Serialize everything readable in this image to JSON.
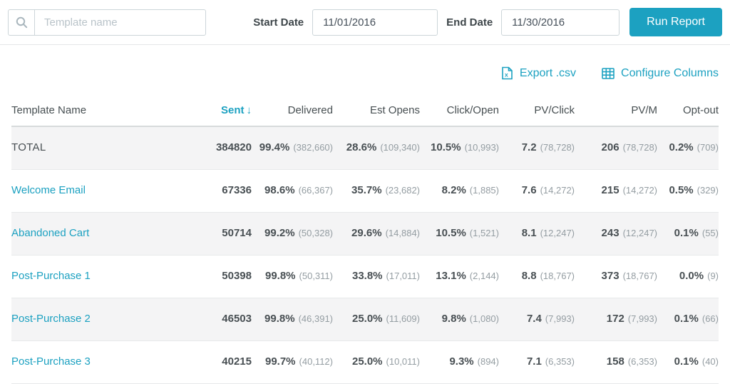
{
  "colors": {
    "accent": "#1ca1c1",
    "text_dark": "#474e52",
    "text_sub": "#949da2",
    "stripe": "#f4f4f5"
  },
  "toolbar": {
    "search_placeholder": "Template name",
    "start_date_label": "Start Date",
    "start_date_value": "11/01/2016",
    "end_date_label": "End Date",
    "end_date_value": "11/30/2016",
    "run_report_label": "Run Report"
  },
  "actions": {
    "export_csv_label": "Export .csv",
    "configure_columns_label": "Configure Columns"
  },
  "table": {
    "sort_arrow": "↓",
    "columns": [
      {
        "key": "name",
        "label": "Template Name",
        "align": "left"
      },
      {
        "key": "sent",
        "label": "Sent",
        "sorted": "desc"
      },
      {
        "key": "delivered",
        "label": "Delivered"
      },
      {
        "key": "est_opens",
        "label": "Est Opens"
      },
      {
        "key": "click_open",
        "label": "Click/Open"
      },
      {
        "key": "pv_click",
        "label": "PV/Click"
      },
      {
        "key": "pv_m",
        "label": "PV/M"
      },
      {
        "key": "opt_out",
        "label": "Opt-out"
      }
    ],
    "rows": [
      {
        "name": "TOTAL",
        "is_total": true,
        "sent": "384820",
        "delivered": {
          "main": "99.4%",
          "sub": "(382,660)"
        },
        "est_opens": {
          "main": "28.6%",
          "sub": "(109,340)"
        },
        "click_open": {
          "main": "10.5%",
          "sub": "(10,993)"
        },
        "pv_click": {
          "main": "7.2",
          "sub": "(78,728)"
        },
        "pv_m": {
          "main": "206",
          "sub": "(78,728)"
        },
        "opt_out": {
          "main": "0.2%",
          "sub": "(709)"
        }
      },
      {
        "name": "Welcome Email",
        "is_total": false,
        "sent": "67336",
        "delivered": {
          "main": "98.6%",
          "sub": "(66,367)"
        },
        "est_opens": {
          "main": "35.7%",
          "sub": "(23,682)"
        },
        "click_open": {
          "main": "8.2%",
          "sub": "(1,885)"
        },
        "pv_click": {
          "main": "7.6",
          "sub": "(14,272)"
        },
        "pv_m": {
          "main": "215",
          "sub": "(14,272)"
        },
        "opt_out": {
          "main": "0.5%",
          "sub": "(329)"
        }
      },
      {
        "name": "Abandoned Cart",
        "is_total": false,
        "sent": "50714",
        "delivered": {
          "main": "99.2%",
          "sub": "(50,328)"
        },
        "est_opens": {
          "main": "29.6%",
          "sub": "(14,884)"
        },
        "click_open": {
          "main": "10.5%",
          "sub": "(1,521)"
        },
        "pv_click": {
          "main": "8.1",
          "sub": "(12,247)"
        },
        "pv_m": {
          "main": "243",
          "sub": "(12,247)"
        },
        "opt_out": {
          "main": "0.1%",
          "sub": "(55)"
        }
      },
      {
        "name": "Post-Purchase 1",
        "is_total": false,
        "sent": "50398",
        "delivered": {
          "main": "99.8%",
          "sub": "(50,311)"
        },
        "est_opens": {
          "main": "33.8%",
          "sub": "(17,011)"
        },
        "click_open": {
          "main": "13.1%",
          "sub": "(2,144)"
        },
        "pv_click": {
          "main": "8.8",
          "sub": "(18,767)"
        },
        "pv_m": {
          "main": "373",
          "sub": "(18,767)"
        },
        "opt_out": {
          "main": "0.0%",
          "sub": "(9)"
        }
      },
      {
        "name": "Post-Purchase 2",
        "is_total": false,
        "sent": "46503",
        "delivered": {
          "main": "99.8%",
          "sub": "(46,391)"
        },
        "est_opens": {
          "main": "25.0%",
          "sub": "(11,609)"
        },
        "click_open": {
          "main": "9.8%",
          "sub": "(1,080)"
        },
        "pv_click": {
          "main": "7.4",
          "sub": "(7,993)"
        },
        "pv_m": {
          "main": "172",
          "sub": "(7,993)"
        },
        "opt_out": {
          "main": "0.1%",
          "sub": "(66)"
        }
      },
      {
        "name": "Post-Purchase 3",
        "is_total": false,
        "sent": "40215",
        "delivered": {
          "main": "99.7%",
          "sub": "(40,112)"
        },
        "est_opens": {
          "main": "25.0%",
          "sub": "(10,011)"
        },
        "click_open": {
          "main": "9.3%",
          "sub": "(894)"
        },
        "pv_click": {
          "main": "7.1",
          "sub": "(6,353)"
        },
        "pv_m": {
          "main": "158",
          "sub": "(6,353)"
        },
        "opt_out": {
          "main": "0.1%",
          "sub": "(40)"
        }
      }
    ]
  }
}
